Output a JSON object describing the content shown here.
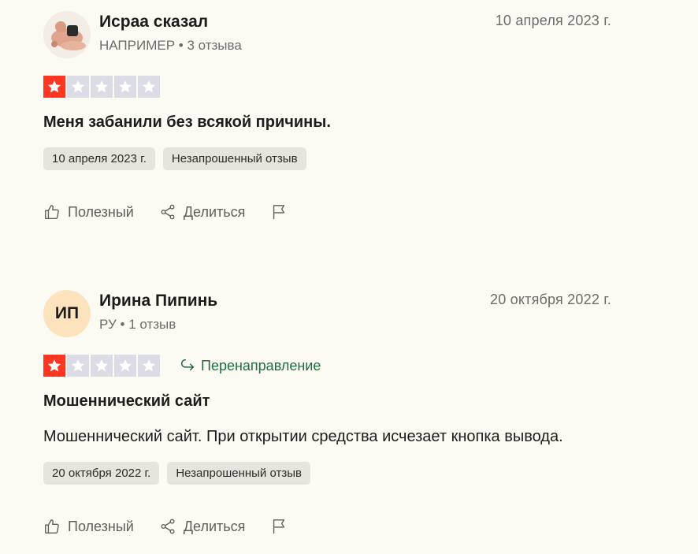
{
  "reviews": [
    {
      "author": "Исраа сказал",
      "country": "НАПРИМЕР",
      "review_count": "3 отзыва",
      "date": "10 апреля 2023 г.",
      "rating": 1,
      "rating_max": 5,
      "redirect_label": "",
      "title": "Меня забанили без всякой причины.",
      "body": "",
      "chips": [
        "10 апреля 2023 г.",
        "Незапрошенный отзыв"
      ],
      "useful_label": "Полезный",
      "share_label": "Делиться"
    },
    {
      "author": "Ирина Пипинь",
      "initials": "ИП",
      "country": "РУ",
      "review_count": "1 отзыв",
      "date": "20 октября 2022 г.",
      "rating": 1,
      "rating_max": 5,
      "redirect_label": "Перенаправление",
      "title": "Мошеннический сайт",
      "body": "Мошеннический сайт. При открытии средства исчезает кнопка вывода.",
      "chips": [
        "20 октября 2022 г.",
        "Незапрошенный отзыв"
      ],
      "useful_label": "Полезный",
      "share_label": "Делиться"
    }
  ],
  "colors": {
    "star_active": "#ff3722",
    "star_inactive": "#dcdce6",
    "redirect_green": "#1d6d3c",
    "initials_bg": "#fde3bd"
  },
  "icons": [
    "thumbs-up-icon",
    "share-icon",
    "flag-icon",
    "redirect-arrow-icon",
    "star-icon"
  ]
}
